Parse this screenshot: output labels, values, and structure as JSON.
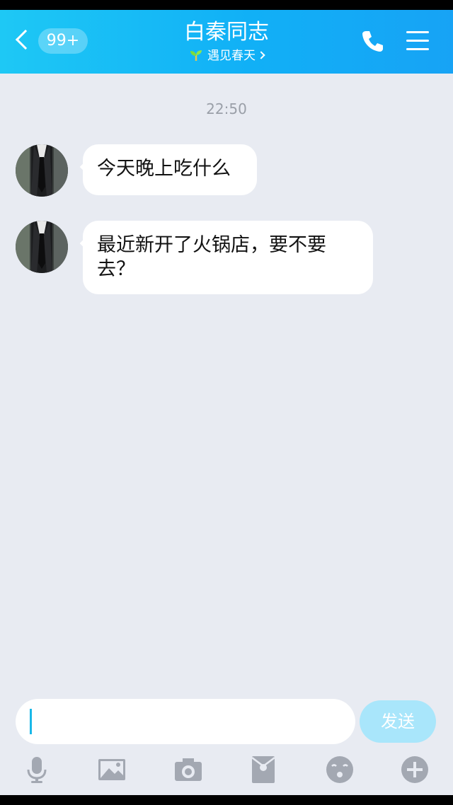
{
  "header": {
    "back_badge": "99+",
    "title": "白秦同志",
    "subtitle": "遇见春天"
  },
  "chat": {
    "timestamp": "22:50",
    "messages": [
      {
        "text": "今天晚上吃什么"
      },
      {
        "text": "最近新开了火锅店，要不要去？"
      }
    ]
  },
  "input": {
    "value": "",
    "send_label": "发送"
  },
  "toolbar": {
    "icons": [
      "microphone-icon",
      "image-icon",
      "camera-icon",
      "red-packet-icon",
      "emoji-icon",
      "plus-icon"
    ]
  },
  "colors": {
    "header_start": "#1ec8f5",
    "header_end": "#17a3f5",
    "background": "#e8ebf2",
    "send_button": "#a9e6fb",
    "toolbar_icon": "#a3a8b2"
  }
}
